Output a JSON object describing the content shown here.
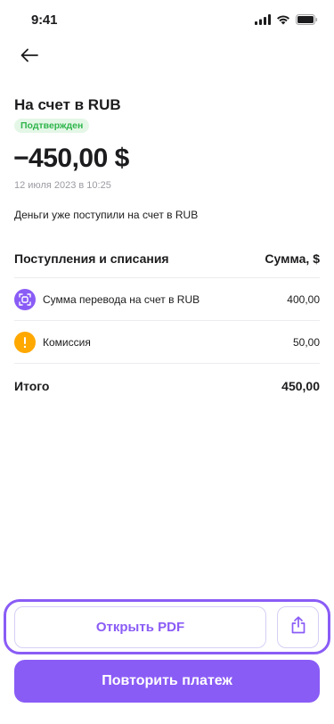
{
  "status_bar": {
    "time": "9:41"
  },
  "header": {
    "title": "На счет в RUB",
    "status_badge": "Подтвержден"
  },
  "transaction": {
    "amount": "−450,00 $",
    "datetime": "12 июля 2023 в 10:25",
    "note": "Деньги уже поступили на счет в RUB"
  },
  "breakdown": {
    "col_label": "Поступления и списания",
    "col_amount": "Сумма, $",
    "rows": [
      {
        "label": "Сумма перевода на счет в RUB",
        "value": "400,00",
        "icon": "transfer-icon"
      },
      {
        "label": "Комиссия",
        "value": "50,00",
        "icon": "exclamation-icon"
      }
    ],
    "total_label": "Итого",
    "total_value": "450,00"
  },
  "actions": {
    "open_pdf": "Открыть PDF",
    "share_icon": "share-icon",
    "repeat_payment": "Повторить платеж"
  },
  "colors": {
    "accent": "#8a5cf6",
    "success": "#2fb54b",
    "warning": "#ffa800"
  }
}
